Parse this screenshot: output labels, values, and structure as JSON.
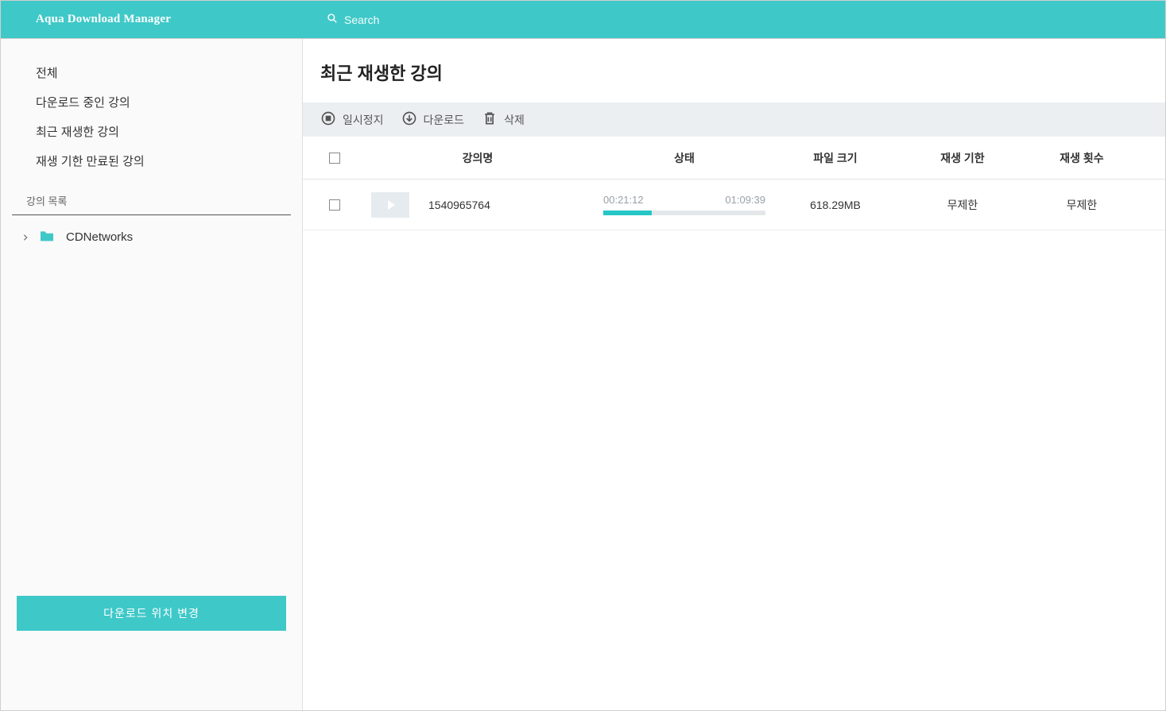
{
  "header": {
    "app_title": "Aqua Download Manager",
    "search_placeholder": "Search"
  },
  "sidebar": {
    "nav": [
      {
        "label": "전체"
      },
      {
        "label": "다운로드 중인 강의"
      },
      {
        "label": "최근 재생한 강의"
      },
      {
        "label": "재생 기한 만료된 강의"
      }
    ],
    "section_label": "강의 목록",
    "tree": [
      {
        "label": "CDNetworks"
      }
    ],
    "change_location_label": "다운로드 위치 변경"
  },
  "main": {
    "title": "최근 재생한 강의",
    "toolbar": {
      "pause_label": "일시정지",
      "download_label": "다운로드",
      "delete_label": "삭제"
    },
    "columns": {
      "name": "강의명",
      "state": "상태",
      "file_size": "파일 크기",
      "deadline": "재생 기한",
      "play_count": "재생 횟수"
    },
    "rows": [
      {
        "name": "1540965764",
        "elapsed": "00:21:12",
        "total": "01:09:39",
        "progress_percent": 30,
        "file_size": "618.29MB",
        "deadline": "무제한",
        "play_count": "무제한"
      }
    ]
  },
  "colors": {
    "accent": "#3fc8c8"
  }
}
